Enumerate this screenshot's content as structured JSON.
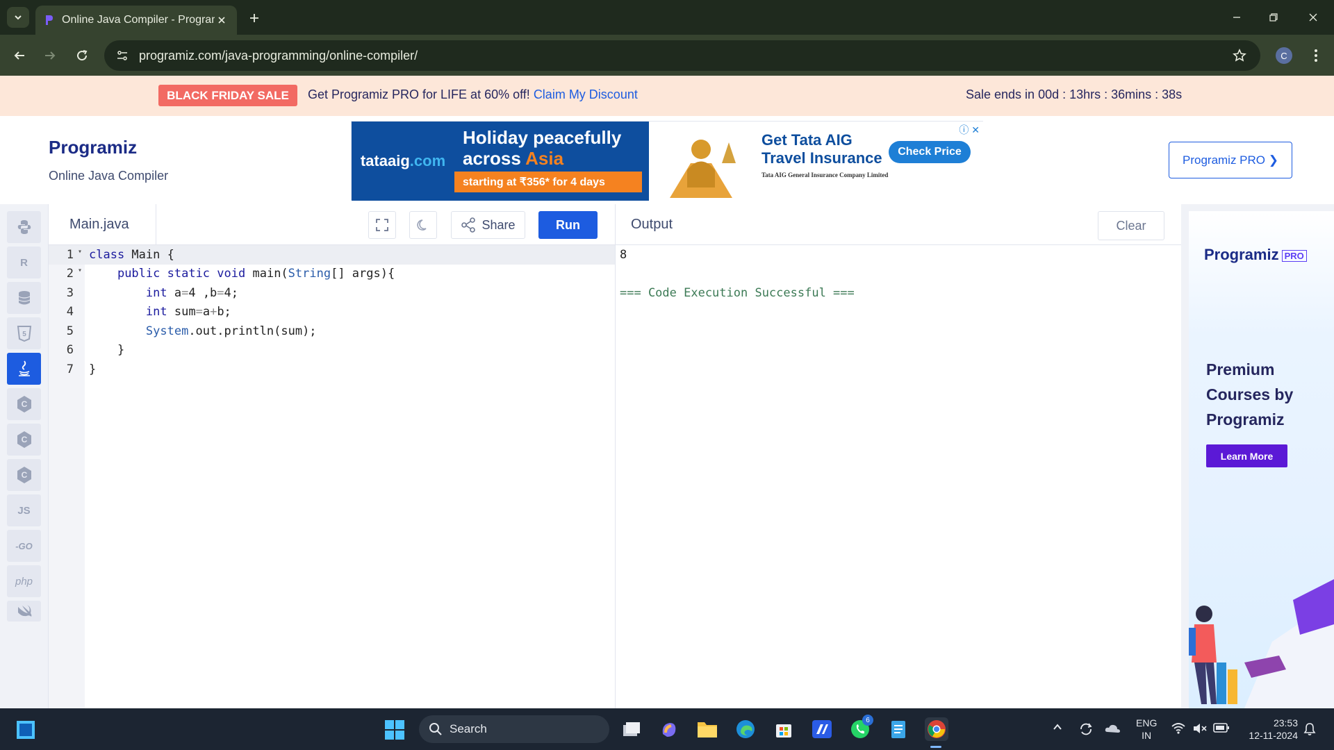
{
  "browser": {
    "tab_title": "Online Java Compiler - Program",
    "url": "programiz.com/java-programming/online-compiler/",
    "profile_initial": "C"
  },
  "promo": {
    "badge": "BLACK FRIDAY SALE",
    "text": "Get Programiz PRO for LIFE at 60% off!",
    "link": "Claim My Discount",
    "sale_ends": "Sale ends in 00d : 13hrs : 36mins : 38s"
  },
  "header": {
    "logo": "Programiz",
    "subtitle": "Online Java Compiler",
    "pro_button": "Programiz PRO ❯"
  },
  "ad": {
    "brand": "tataaig",
    "brand_suffix": ".com",
    "headline_1": "Holiday peacefully",
    "headline_2": "across",
    "headline_2_orange": "Asia",
    "strip": "starting at ₹356* for 4 days",
    "right_title_1": "Get Tata AIG",
    "right_title_2": "Travel Insurance",
    "cta": "Check Price",
    "fine": "Tata AIG General Insurance Company Limited"
  },
  "languages": [
    {
      "name": "python",
      "label": ""
    },
    {
      "name": "r",
      "label": "R"
    },
    {
      "name": "sql",
      "label": ""
    },
    {
      "name": "html",
      "label": "5"
    },
    {
      "name": "java",
      "label": ""
    },
    {
      "name": "c",
      "label": "C"
    },
    {
      "name": "cpp",
      "label": "C"
    },
    {
      "name": "csharp",
      "label": "C"
    },
    {
      "name": "js",
      "label": "JS"
    },
    {
      "name": "go",
      "label": "-GO"
    },
    {
      "name": "php",
      "label": "php"
    },
    {
      "name": "swift",
      "label": ""
    }
  ],
  "editor": {
    "file_name": "Main.java",
    "share_label": "Share",
    "run_label": "Run",
    "lines": [
      {
        "num": "1",
        "fold": "▾"
      },
      {
        "num": "2",
        "fold": "▾"
      },
      {
        "num": "3",
        "fold": ""
      },
      {
        "num": "4",
        "fold": ""
      },
      {
        "num": "5",
        "fold": ""
      },
      {
        "num": "6",
        "fold": ""
      },
      {
        "num": "7",
        "fold": ""
      }
    ]
  },
  "output": {
    "title": "Output",
    "clear_label": "Clear",
    "result": "8",
    "status": "=== Code Execution Successful ==="
  },
  "right_ad": {
    "logo": "Programiz",
    "pro": "PRO",
    "line1": "Premium",
    "line2": "Courses by",
    "line3": "Programiz",
    "button": "Learn More"
  },
  "taskbar": {
    "search_label": "Search",
    "whatsapp_badge": "6",
    "lang_1": "ENG",
    "lang_2": "IN",
    "time": "23:53",
    "date": "12-11-2024"
  }
}
